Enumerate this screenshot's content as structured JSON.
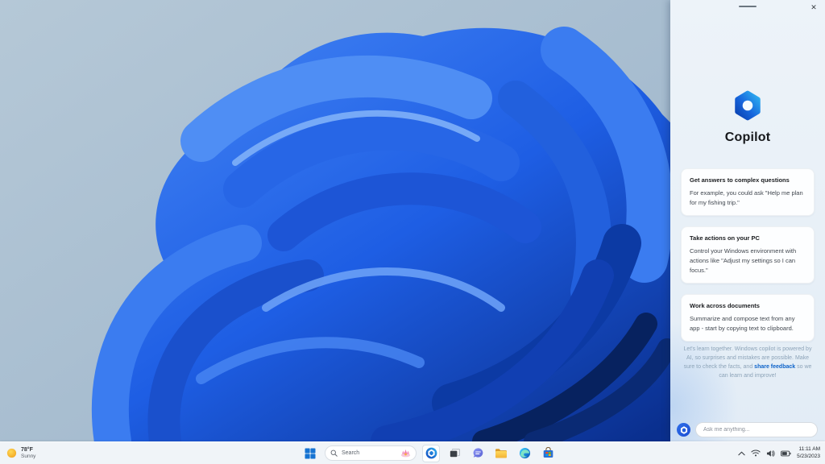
{
  "copilot_panel": {
    "title": "Copilot",
    "close_icon": "✕",
    "cards": [
      {
        "title": "Get answers to complex questions",
        "body": "For example, you could ask \"Help me plan for my fishing trip.\""
      },
      {
        "title": "Take actions on your PC",
        "body": "Control your Windows environment with actions like \"Adjust my settings so I can focus.\""
      },
      {
        "title": "Work across documents",
        "body": "Summarize and compose text from any app - start by copying text to clipboard."
      }
    ],
    "disclaimer": {
      "before_link": "Let's learn together. Windows copilot is powered by AI, so surprises and mistakes are possible. Make sure to check the facts, and ",
      "link": "share feedback",
      "after_link": " so we can learn and improve!"
    },
    "input": {
      "placeholder": "Ask me anything..."
    }
  },
  "taskbar": {
    "weather": {
      "temperature": "78°F",
      "condition": "Sunny"
    },
    "search": {
      "label": "Search"
    },
    "app_icons": [
      "start",
      "search",
      "copilot",
      "task-view",
      "chat",
      "file-explorer",
      "edge",
      "microsoft-store"
    ],
    "tray": {
      "icons": [
        "hidden-icons-chevron",
        "wifi",
        "volume",
        "battery"
      ],
      "time": "11:11 AM",
      "date": "5/23/2023"
    }
  },
  "colors": {
    "accent_blue": "#1b57e0",
    "copilot_cyan": "#2aa3f0",
    "panel_bg": "#e8f0f7",
    "card_bg": "#fdfeff",
    "link": "#0c63c9",
    "taskbar_bg": "#f2f6fa",
    "wallpaper_sky": "#aec3d5",
    "wallpaper_blue": "#2467e6",
    "wallpaper_dark": "#0a2f8e"
  }
}
